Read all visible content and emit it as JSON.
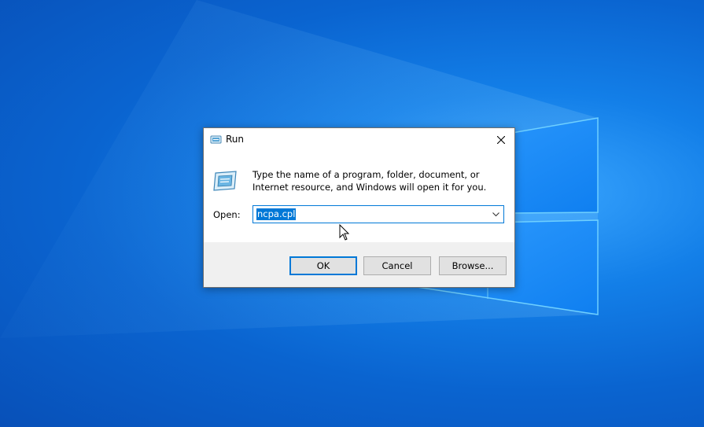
{
  "dialog": {
    "title": "Run",
    "description": "Type the name of a program, folder, document, or Internet resource, and Windows will open it for you.",
    "open_label": "Open:",
    "open_value": "ncpa.cpl",
    "buttons": {
      "ok": "OK",
      "cancel": "Cancel",
      "browse": "Browse..."
    }
  },
  "icons": {
    "title": "run-icon",
    "close": "close-icon",
    "dropdown": "chevron-down-icon",
    "cursor": "mouse-pointer-icon"
  },
  "colors": {
    "accent": "#0078d7",
    "desktop": "#0a64d0"
  }
}
